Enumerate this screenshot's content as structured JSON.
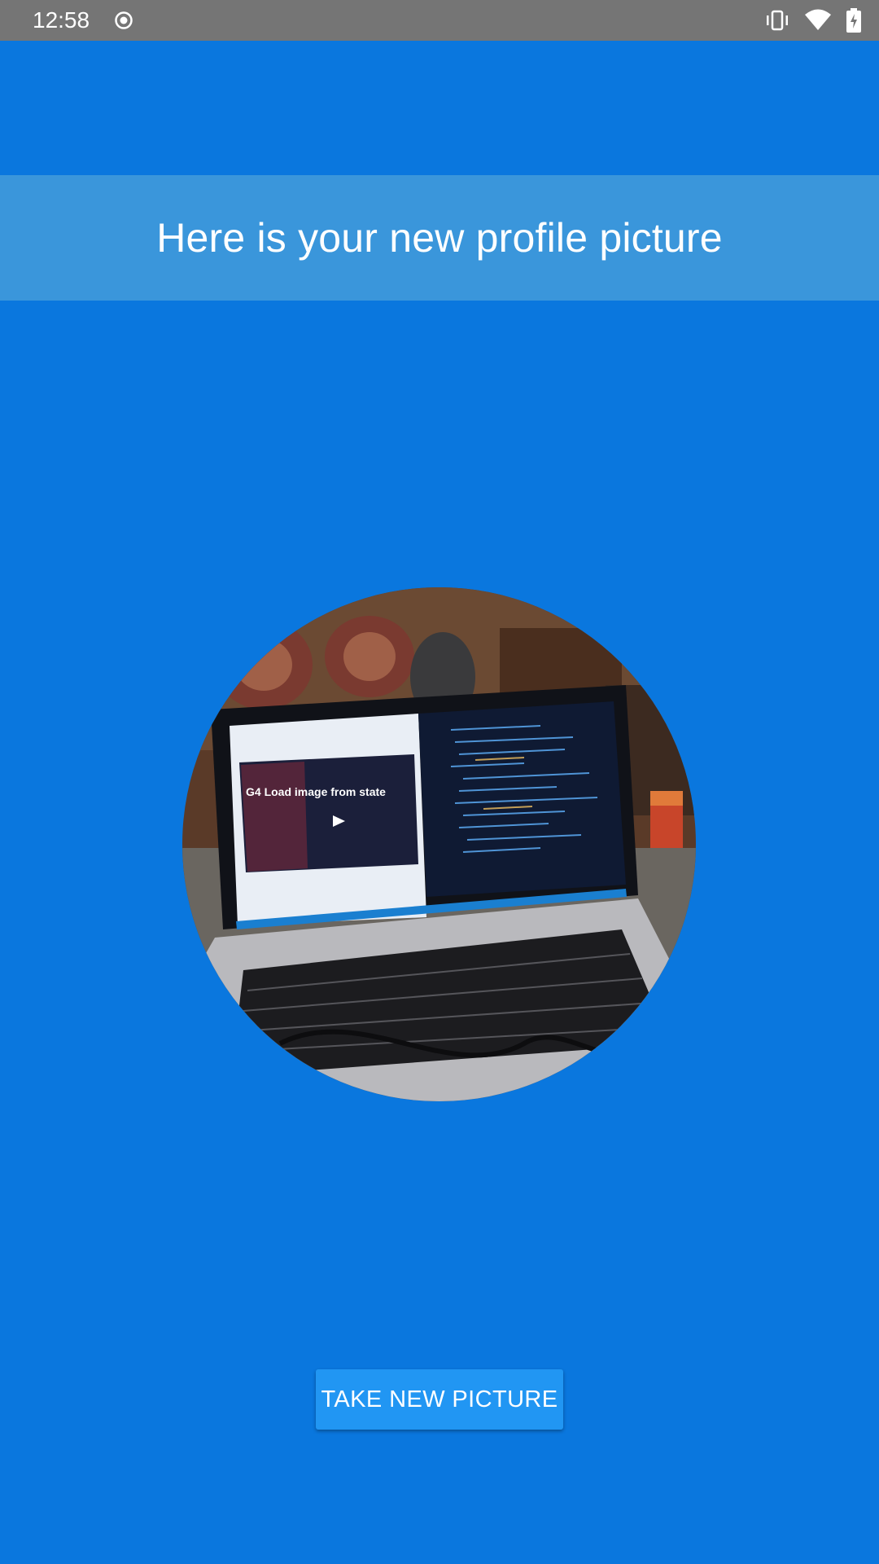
{
  "status_bar": {
    "time": "12:58",
    "icons": [
      "record-icon",
      "vibrate-icon",
      "wifi-icon",
      "battery-charging-icon"
    ]
  },
  "header": {
    "title": "Here is your new profile picture"
  },
  "profile_photo": {
    "description_icon": "profile-photo",
    "screen_heading": "G4 Load image from state"
  },
  "actions": {
    "take_new_picture_label": "TAKE NEW PICTURE"
  },
  "colors": {
    "background": "#0a77de",
    "title_band": "#3a96db",
    "button": "#2196f3",
    "status_bar": "#757575"
  }
}
